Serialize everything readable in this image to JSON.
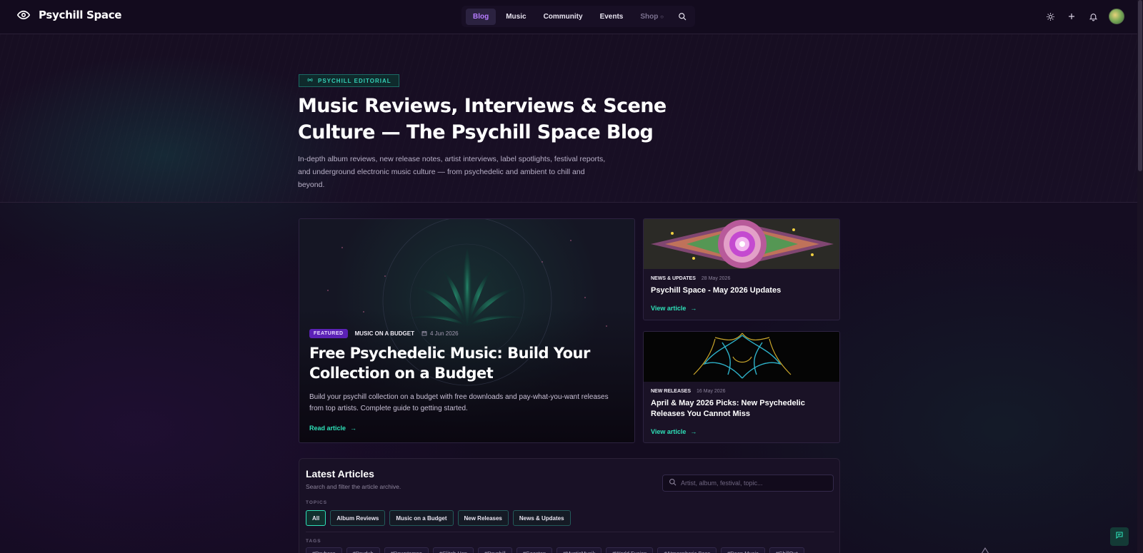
{
  "header": {
    "brand": "Psychill Space",
    "nav": [
      {
        "label": "Blog",
        "active": true
      },
      {
        "label": "Music"
      },
      {
        "label": "Community"
      },
      {
        "label": "Events"
      },
      {
        "label": "Shop",
        "muted": true
      }
    ]
  },
  "hero": {
    "eyebrow": "PSYCHILL EDITORIAL",
    "title": "Music Reviews, Interviews & Scene Culture — The Psychill Space Blog",
    "subtitle": "In-depth album reviews, new release notes, artist interviews, label spotlights, festival reports, and underground electronic music culture — from psychedelic and ambient to chill and beyond."
  },
  "featured": {
    "badge": "FEATURED",
    "category": "MUSIC ON A BUDGET",
    "date": "4 Jun 2026",
    "title": "Free Psychedelic Music: Build Your Collection on a Budget",
    "description": "Build your psychill collection on a budget with free downloads and pay-what-you-want releases from top artists. Complete guide to getting started.",
    "link": "Read article"
  },
  "side_cards": [
    {
      "category": "NEWS & UPDATES",
      "date": "28 May 2026",
      "title": "Psychill Space - May 2026 Updates",
      "link": "View article"
    },
    {
      "category": "NEW RELEASES",
      "date": "16 May 2026",
      "title": "April & May 2026 Picks: New Psychedelic Releases You Cannot Miss",
      "link": "View article"
    }
  ],
  "latest": {
    "title": "Latest Articles",
    "subtitle": "Search and filter the article archive.",
    "search_placeholder": "Artist, album, festival, topic...",
    "topics_label": "TOPICS",
    "topics": [
      {
        "label": "All",
        "active": true
      },
      {
        "label": "Album Reviews"
      },
      {
        "label": "Music on a Budget"
      },
      {
        "label": "New Releases"
      },
      {
        "label": "News & Updates"
      }
    ],
    "tags_label": "TAGS",
    "tags": [
      "#Psybass",
      "#Psydub",
      "#Downtempo",
      "#Glitch Hop",
      "#Psychill",
      "#Goastep",
      "#MysticMusik",
      "#World Fusion",
      "#Atmospheric Bass",
      "#Deep Music",
      "#ChillOut"
    ]
  },
  "colors": {
    "accent": "#2ee0b8",
    "nav_active": "#b67cff",
    "featured_badge": "#5b21b6"
  }
}
